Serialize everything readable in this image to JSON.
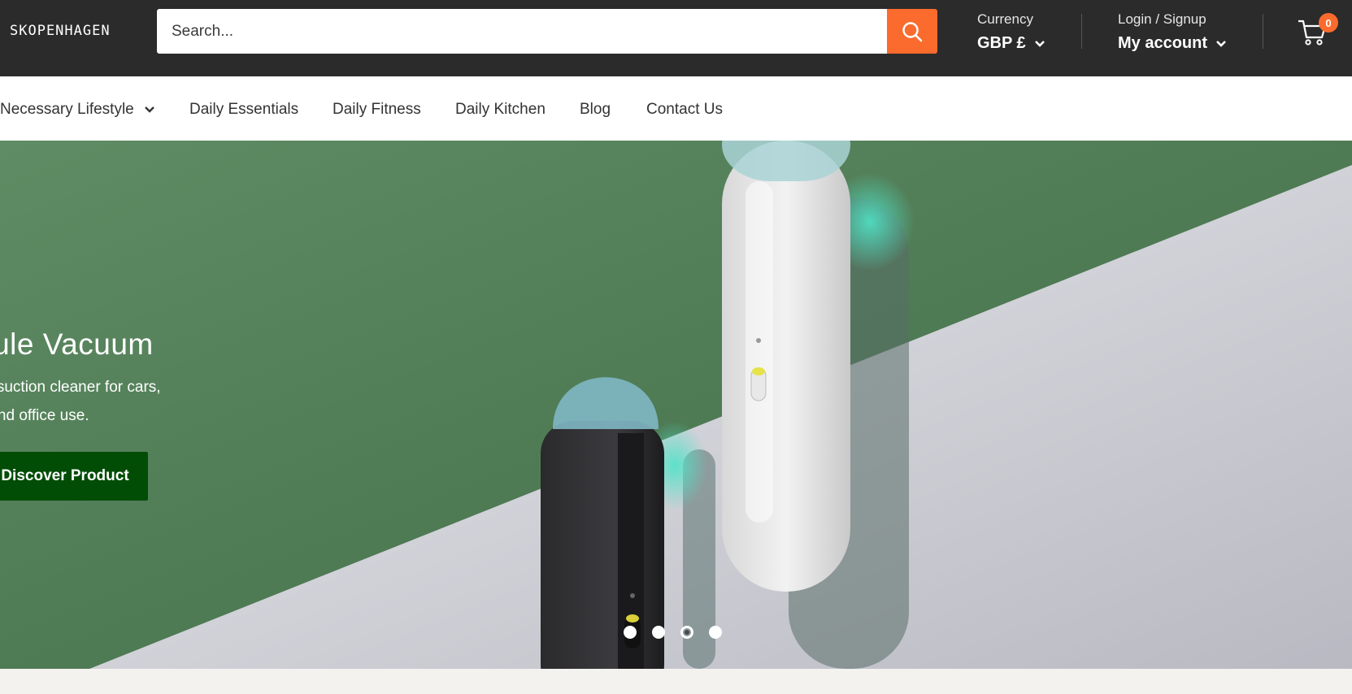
{
  "header": {
    "logo": "SKOPENHAGEN",
    "search_placeholder": "Search...",
    "currency_label": "Currency",
    "currency_value": "GBP £",
    "login_label": "Login / Signup",
    "account_label": "My account",
    "cart_count": "0",
    "accent_color": "#fb6b2d"
  },
  "nav": {
    "items": [
      {
        "label": "Necessary Lifestyle",
        "has_dropdown": true
      },
      {
        "label": "Daily Essentials"
      },
      {
        "label": "Daily Fitness"
      },
      {
        "label": "Daily Kitchen"
      },
      {
        "label": "Blog"
      },
      {
        "label": "Contact Us"
      }
    ]
  },
  "hero": {
    "title": "psule Vacuum",
    "subtitle_line1": "ess suction cleaner for cars,",
    "subtitle_line2": "os and office use.",
    "button_label": "Discover Product",
    "button_color": "#024d06",
    "slide_count": 4,
    "active_slide": 3
  }
}
